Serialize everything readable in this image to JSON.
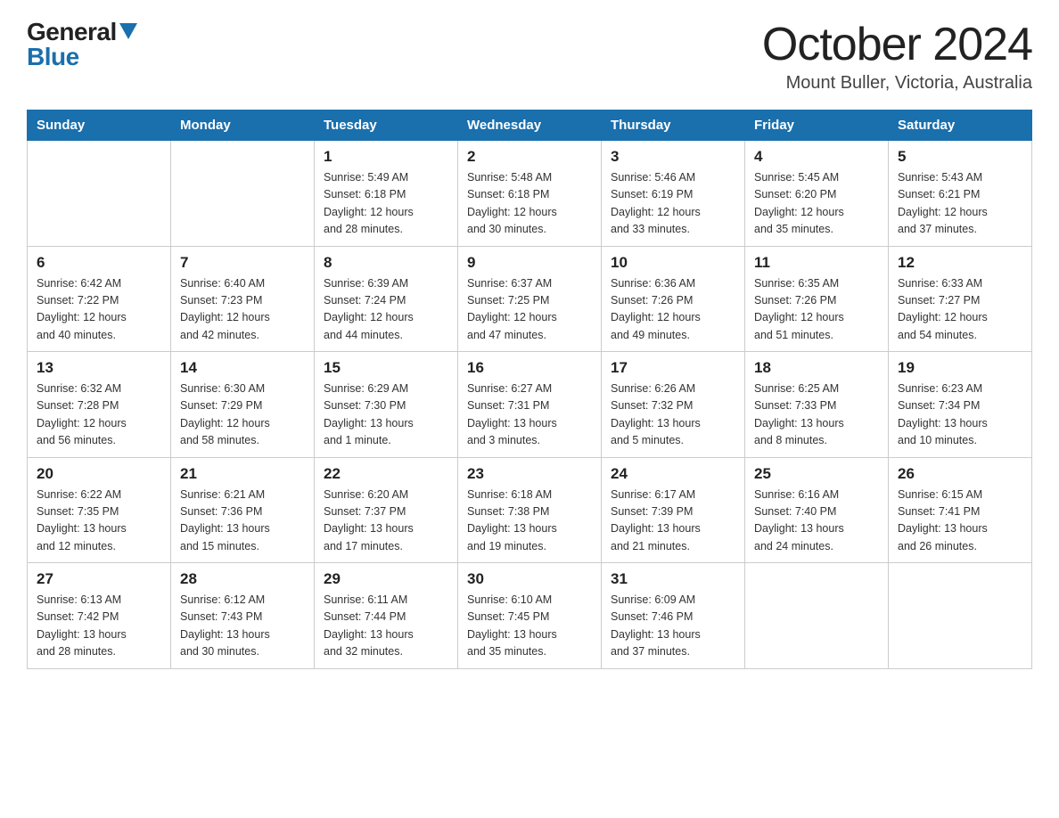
{
  "logo": {
    "general": "General",
    "blue": "Blue"
  },
  "title": "October 2024",
  "subtitle": "Mount Buller, Victoria, Australia",
  "days_header": [
    "Sunday",
    "Monday",
    "Tuesday",
    "Wednesday",
    "Thursday",
    "Friday",
    "Saturday"
  ],
  "weeks": [
    [
      {
        "day": "",
        "info": ""
      },
      {
        "day": "",
        "info": ""
      },
      {
        "day": "1",
        "info": "Sunrise: 5:49 AM\nSunset: 6:18 PM\nDaylight: 12 hours\nand 28 minutes."
      },
      {
        "day": "2",
        "info": "Sunrise: 5:48 AM\nSunset: 6:18 PM\nDaylight: 12 hours\nand 30 minutes."
      },
      {
        "day": "3",
        "info": "Sunrise: 5:46 AM\nSunset: 6:19 PM\nDaylight: 12 hours\nand 33 minutes."
      },
      {
        "day": "4",
        "info": "Sunrise: 5:45 AM\nSunset: 6:20 PM\nDaylight: 12 hours\nand 35 minutes."
      },
      {
        "day": "5",
        "info": "Sunrise: 5:43 AM\nSunset: 6:21 PM\nDaylight: 12 hours\nand 37 minutes."
      }
    ],
    [
      {
        "day": "6",
        "info": "Sunrise: 6:42 AM\nSunset: 7:22 PM\nDaylight: 12 hours\nand 40 minutes."
      },
      {
        "day": "7",
        "info": "Sunrise: 6:40 AM\nSunset: 7:23 PM\nDaylight: 12 hours\nand 42 minutes."
      },
      {
        "day": "8",
        "info": "Sunrise: 6:39 AM\nSunset: 7:24 PM\nDaylight: 12 hours\nand 44 minutes."
      },
      {
        "day": "9",
        "info": "Sunrise: 6:37 AM\nSunset: 7:25 PM\nDaylight: 12 hours\nand 47 minutes."
      },
      {
        "day": "10",
        "info": "Sunrise: 6:36 AM\nSunset: 7:26 PM\nDaylight: 12 hours\nand 49 minutes."
      },
      {
        "day": "11",
        "info": "Sunrise: 6:35 AM\nSunset: 7:26 PM\nDaylight: 12 hours\nand 51 minutes."
      },
      {
        "day": "12",
        "info": "Sunrise: 6:33 AM\nSunset: 7:27 PM\nDaylight: 12 hours\nand 54 minutes."
      }
    ],
    [
      {
        "day": "13",
        "info": "Sunrise: 6:32 AM\nSunset: 7:28 PM\nDaylight: 12 hours\nand 56 minutes."
      },
      {
        "day": "14",
        "info": "Sunrise: 6:30 AM\nSunset: 7:29 PM\nDaylight: 12 hours\nand 58 minutes."
      },
      {
        "day": "15",
        "info": "Sunrise: 6:29 AM\nSunset: 7:30 PM\nDaylight: 13 hours\nand 1 minute."
      },
      {
        "day": "16",
        "info": "Sunrise: 6:27 AM\nSunset: 7:31 PM\nDaylight: 13 hours\nand 3 minutes."
      },
      {
        "day": "17",
        "info": "Sunrise: 6:26 AM\nSunset: 7:32 PM\nDaylight: 13 hours\nand 5 minutes."
      },
      {
        "day": "18",
        "info": "Sunrise: 6:25 AM\nSunset: 7:33 PM\nDaylight: 13 hours\nand 8 minutes."
      },
      {
        "day": "19",
        "info": "Sunrise: 6:23 AM\nSunset: 7:34 PM\nDaylight: 13 hours\nand 10 minutes."
      }
    ],
    [
      {
        "day": "20",
        "info": "Sunrise: 6:22 AM\nSunset: 7:35 PM\nDaylight: 13 hours\nand 12 minutes."
      },
      {
        "day": "21",
        "info": "Sunrise: 6:21 AM\nSunset: 7:36 PM\nDaylight: 13 hours\nand 15 minutes."
      },
      {
        "day": "22",
        "info": "Sunrise: 6:20 AM\nSunset: 7:37 PM\nDaylight: 13 hours\nand 17 minutes."
      },
      {
        "day": "23",
        "info": "Sunrise: 6:18 AM\nSunset: 7:38 PM\nDaylight: 13 hours\nand 19 minutes."
      },
      {
        "day": "24",
        "info": "Sunrise: 6:17 AM\nSunset: 7:39 PM\nDaylight: 13 hours\nand 21 minutes."
      },
      {
        "day": "25",
        "info": "Sunrise: 6:16 AM\nSunset: 7:40 PM\nDaylight: 13 hours\nand 24 minutes."
      },
      {
        "day": "26",
        "info": "Sunrise: 6:15 AM\nSunset: 7:41 PM\nDaylight: 13 hours\nand 26 minutes."
      }
    ],
    [
      {
        "day": "27",
        "info": "Sunrise: 6:13 AM\nSunset: 7:42 PM\nDaylight: 13 hours\nand 28 minutes."
      },
      {
        "day": "28",
        "info": "Sunrise: 6:12 AM\nSunset: 7:43 PM\nDaylight: 13 hours\nand 30 minutes."
      },
      {
        "day": "29",
        "info": "Sunrise: 6:11 AM\nSunset: 7:44 PM\nDaylight: 13 hours\nand 32 minutes."
      },
      {
        "day": "30",
        "info": "Sunrise: 6:10 AM\nSunset: 7:45 PM\nDaylight: 13 hours\nand 35 minutes."
      },
      {
        "day": "31",
        "info": "Sunrise: 6:09 AM\nSunset: 7:46 PM\nDaylight: 13 hours\nand 37 minutes."
      },
      {
        "day": "",
        "info": ""
      },
      {
        "day": "",
        "info": ""
      }
    ]
  ]
}
